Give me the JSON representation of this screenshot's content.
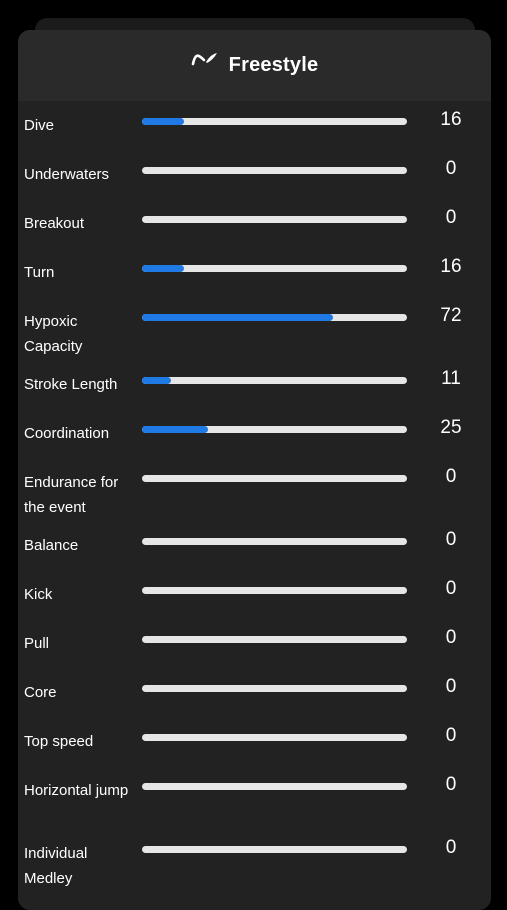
{
  "header": {
    "title": "Freestyle",
    "icon": "swim-stroke-icon"
  },
  "colors": {
    "background": "#000000",
    "card": "#222222",
    "header": "#2a2a2a",
    "track": "#e6e6e6",
    "accent": "#1f7ae6",
    "text": "#ffffff"
  },
  "max_value": 100,
  "metrics": [
    {
      "label": "Dive",
      "value": 16
    },
    {
      "label": "Underwaters",
      "value": 0
    },
    {
      "label": "Breakout",
      "value": 0
    },
    {
      "label": "Turn",
      "value": 16
    },
    {
      "label": "Hypoxic Capacity",
      "value": 72
    },
    {
      "label": "Stroke Length",
      "value": 11
    },
    {
      "label": "Coordination",
      "value": 25
    },
    {
      "label": "Endurance for the event",
      "value": 0
    },
    {
      "label": "Balance",
      "value": 0
    },
    {
      "label": "Kick",
      "value": 0
    },
    {
      "label": "Pull",
      "value": 0
    },
    {
      "label": "Core",
      "value": 0
    },
    {
      "label": "Top speed",
      "value": 0
    },
    {
      "label": "Horizontal jump",
      "value": 0
    },
    {
      "label": "Individual Medley",
      "value": 0
    }
  ]
}
